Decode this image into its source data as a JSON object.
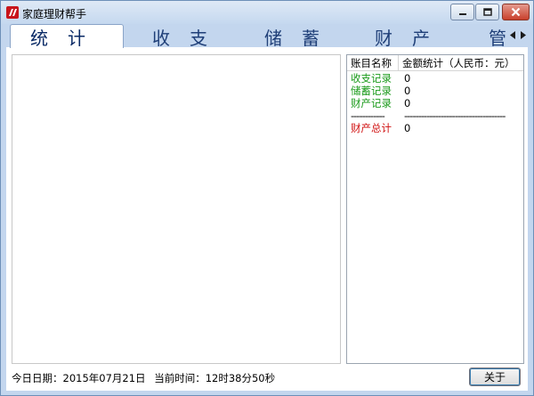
{
  "window": {
    "title": "家庭理财帮手"
  },
  "tabs": [
    {
      "label": "统计",
      "active": true
    },
    {
      "label": "收支",
      "active": false
    },
    {
      "label": "储蓄",
      "active": false
    },
    {
      "label": "财产",
      "active": false
    },
    {
      "label": "管",
      "active": false
    }
  ],
  "summary_table": {
    "columns": [
      "账目名称",
      "金额统计（人民币：元）"
    ],
    "rows": [
      {
        "name": "收支记录",
        "value": "0",
        "color": "#1a9a1a"
      },
      {
        "name": "储蓄记录",
        "value": "0",
        "color": "#1a9a1a"
      },
      {
        "name": "财产记录",
        "value": "0",
        "color": "#1a9a1a"
      },
      {
        "name": "------------",
        "value": "------------------------------------"
      },
      {
        "name": "财产总计",
        "value": "0",
        "color": "#d01010"
      }
    ]
  },
  "status": {
    "date_label": "今日日期：",
    "date_value": "2015年07月21日",
    "time_label": "当前时间：",
    "time_value": "12时38分50秒"
  },
  "buttons": {
    "about": "关于"
  },
  "icons": {
    "app": "app-logo-icon",
    "minimize": "minimize-icon",
    "maximize": "maximize-icon",
    "close": "close-icon",
    "tab_left": "tab-scroll-left-icon",
    "tab_right": "tab-scroll-right-icon"
  },
  "colors": {
    "accent_green": "#1a9a1a",
    "accent_red": "#d01010",
    "tab_text": "#1f3f78"
  }
}
